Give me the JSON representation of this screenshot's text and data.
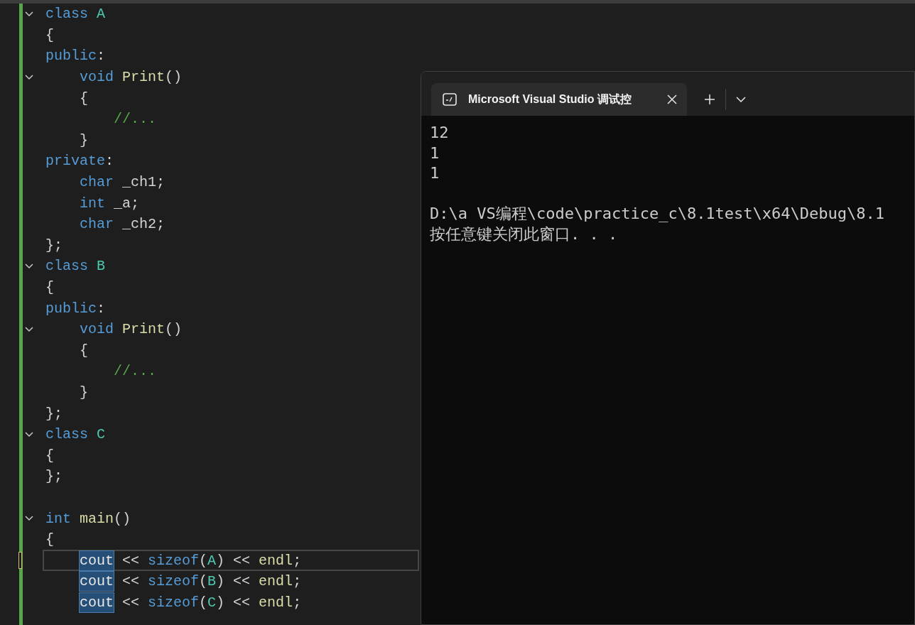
{
  "editor": {
    "lines": [
      {
        "kind": "code",
        "fold": true,
        "current": false,
        "tokens": [
          {
            "kind": "keyword",
            "text": "class "
          },
          {
            "kind": "type",
            "text": "A"
          }
        ]
      },
      {
        "kind": "code",
        "fold": false,
        "current": false,
        "tokens": [
          {
            "kind": "plain",
            "text": "{"
          }
        ]
      },
      {
        "kind": "code",
        "fold": false,
        "current": false,
        "tokens": [
          {
            "kind": "keyword",
            "text": "public"
          },
          {
            "kind": "plain",
            "text": ":"
          }
        ]
      },
      {
        "kind": "code",
        "fold": true,
        "current": false,
        "tokens": [
          {
            "kind": "keyword",
            "text": "    void "
          },
          {
            "kind": "function",
            "text": "Print"
          },
          {
            "kind": "plain",
            "text": "()"
          }
        ]
      },
      {
        "kind": "code",
        "fold": false,
        "current": false,
        "tokens": [
          {
            "kind": "plain",
            "text": "    {"
          }
        ]
      },
      {
        "kind": "code",
        "fold": false,
        "current": false,
        "tokens": [
          {
            "kind": "comment",
            "text": "        //..."
          }
        ]
      },
      {
        "kind": "code",
        "fold": false,
        "current": false,
        "tokens": [
          {
            "kind": "plain",
            "text": "    }"
          }
        ]
      },
      {
        "kind": "code",
        "fold": false,
        "current": false,
        "tokens": [
          {
            "kind": "keyword",
            "text": "private"
          },
          {
            "kind": "plain",
            "text": ":"
          }
        ]
      },
      {
        "kind": "code",
        "fold": false,
        "current": false,
        "tokens": [
          {
            "kind": "keyword",
            "text": "    char"
          },
          {
            "kind": "plain",
            "text": " _ch1;"
          }
        ]
      },
      {
        "kind": "code",
        "fold": false,
        "current": false,
        "tokens": [
          {
            "kind": "keyword",
            "text": "    int"
          },
          {
            "kind": "plain",
            "text": " _a;"
          }
        ]
      },
      {
        "kind": "code",
        "fold": false,
        "current": false,
        "tokens": [
          {
            "kind": "keyword",
            "text": "    char"
          },
          {
            "kind": "plain",
            "text": " _ch2;"
          }
        ]
      },
      {
        "kind": "code",
        "fold": false,
        "current": false,
        "tokens": [
          {
            "kind": "plain",
            "text": "};"
          }
        ]
      },
      {
        "kind": "code",
        "fold": true,
        "current": false,
        "tokens": [
          {
            "kind": "keyword",
            "text": "class "
          },
          {
            "kind": "type",
            "text": "B"
          }
        ]
      },
      {
        "kind": "code",
        "fold": false,
        "current": false,
        "tokens": [
          {
            "kind": "plain",
            "text": "{"
          }
        ]
      },
      {
        "kind": "code",
        "fold": false,
        "current": false,
        "tokens": [
          {
            "kind": "keyword",
            "text": "public"
          },
          {
            "kind": "plain",
            "text": ":"
          }
        ]
      },
      {
        "kind": "code",
        "fold": true,
        "current": false,
        "tokens": [
          {
            "kind": "keyword",
            "text": "    void "
          },
          {
            "kind": "function",
            "text": "Print"
          },
          {
            "kind": "plain",
            "text": "()"
          }
        ]
      },
      {
        "kind": "code",
        "fold": false,
        "current": false,
        "tokens": [
          {
            "kind": "plain",
            "text": "    {"
          }
        ]
      },
      {
        "kind": "code",
        "fold": false,
        "current": false,
        "tokens": [
          {
            "kind": "comment",
            "text": "        //..."
          }
        ]
      },
      {
        "kind": "code",
        "fold": false,
        "current": false,
        "tokens": [
          {
            "kind": "plain",
            "text": "    }"
          }
        ]
      },
      {
        "kind": "code",
        "fold": false,
        "current": false,
        "tokens": [
          {
            "kind": "plain",
            "text": "};"
          }
        ]
      },
      {
        "kind": "code",
        "fold": true,
        "current": false,
        "tokens": [
          {
            "kind": "keyword",
            "text": "class "
          },
          {
            "kind": "type",
            "text": "C"
          }
        ]
      },
      {
        "kind": "code",
        "fold": false,
        "current": false,
        "tokens": [
          {
            "kind": "plain",
            "text": "{"
          }
        ]
      },
      {
        "kind": "code",
        "fold": false,
        "current": false,
        "tokens": [
          {
            "kind": "plain",
            "text": "};"
          }
        ]
      },
      {
        "kind": "blank"
      },
      {
        "kind": "code",
        "fold": true,
        "current": false,
        "tokens": [
          {
            "kind": "keyword",
            "text": "int "
          },
          {
            "kind": "function",
            "text": "main"
          },
          {
            "kind": "plain",
            "text": "()"
          }
        ]
      },
      {
        "kind": "code",
        "fold": false,
        "current": false,
        "tokens": [
          {
            "kind": "plain",
            "text": "{"
          }
        ]
      },
      {
        "kind": "code",
        "fold": false,
        "current": true,
        "tokens": [
          {
            "kind": "selection",
            "text": "    cout"
          },
          {
            "kind": "plain",
            "text": " << "
          },
          {
            "kind": "keyword",
            "text": "sizeof"
          },
          {
            "kind": "plain",
            "text": "("
          },
          {
            "kind": "type",
            "text": "A"
          },
          {
            "kind": "plain",
            "text": ") << "
          },
          {
            "kind": "function",
            "text": "endl"
          },
          {
            "kind": "plain",
            "text": ";"
          }
        ]
      },
      {
        "kind": "code",
        "fold": false,
        "current": false,
        "tokens": [
          {
            "kind": "selection",
            "text": "    cout"
          },
          {
            "kind": "plain",
            "text": " << "
          },
          {
            "kind": "keyword",
            "text": "sizeof"
          },
          {
            "kind": "plain",
            "text": "("
          },
          {
            "kind": "type",
            "text": "B"
          },
          {
            "kind": "plain",
            "text": ") << "
          },
          {
            "kind": "function",
            "text": "endl"
          },
          {
            "kind": "plain",
            "text": ";"
          }
        ]
      },
      {
        "kind": "code",
        "fold": false,
        "current": false,
        "tokens": [
          {
            "kind": "selection",
            "text": "    cout"
          },
          {
            "kind": "plain",
            "text": " << "
          },
          {
            "kind": "keyword",
            "text": "sizeof"
          },
          {
            "kind": "plain",
            "text": "("
          },
          {
            "kind": "type",
            "text": "C"
          },
          {
            "kind": "plain",
            "text": ") << "
          },
          {
            "kind": "function",
            "text": "endl"
          },
          {
            "kind": "plain",
            "text": ";"
          }
        ]
      }
    ]
  },
  "terminal": {
    "tab": {
      "title": "Microsoft Visual Studio 调试控",
      "selected": true
    },
    "output": [
      [
        "12",
        "1",
        "1"
      ],
      [
        "D:\\a VS编程\\code\\practice_c\\8.1test\\x64\\Debug\\8.1",
        "按任意键关闭此窗口. . ."
      ]
    ]
  }
}
